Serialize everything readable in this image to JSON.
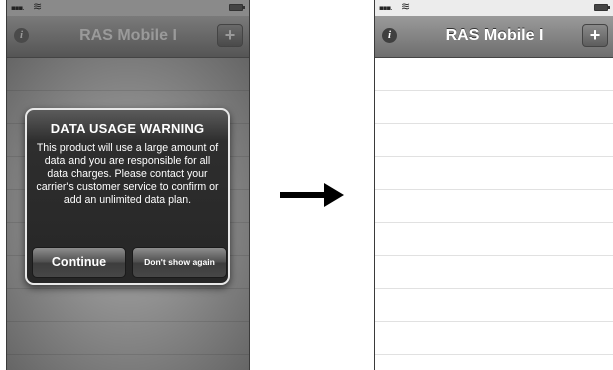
{
  "left_screen": {
    "app_title": "RAS Mobile I",
    "alert": {
      "title": "DATA USAGE WARNING",
      "message": "This product will use a large amount of data and you are responsible for all data charges. Please contact your carrier's customer service to confirm or add an unlimited data plan.",
      "continue_label": "Continue",
      "dont_show_label": "Don't show again"
    }
  },
  "right_screen": {
    "app_title": "RAS Mobile I"
  },
  "icons": {
    "info": "info-icon",
    "add": "plus-icon",
    "signal": "signal-icon",
    "wifi": "wifi-icon",
    "battery": "battery-icon",
    "arrow": "right-arrow-icon"
  },
  "colors": {
    "nav_bar": "#6e6e6e",
    "dimmed_overlay": "#8c8c8c",
    "alert_background": "#262626",
    "arrow": "#000000"
  }
}
